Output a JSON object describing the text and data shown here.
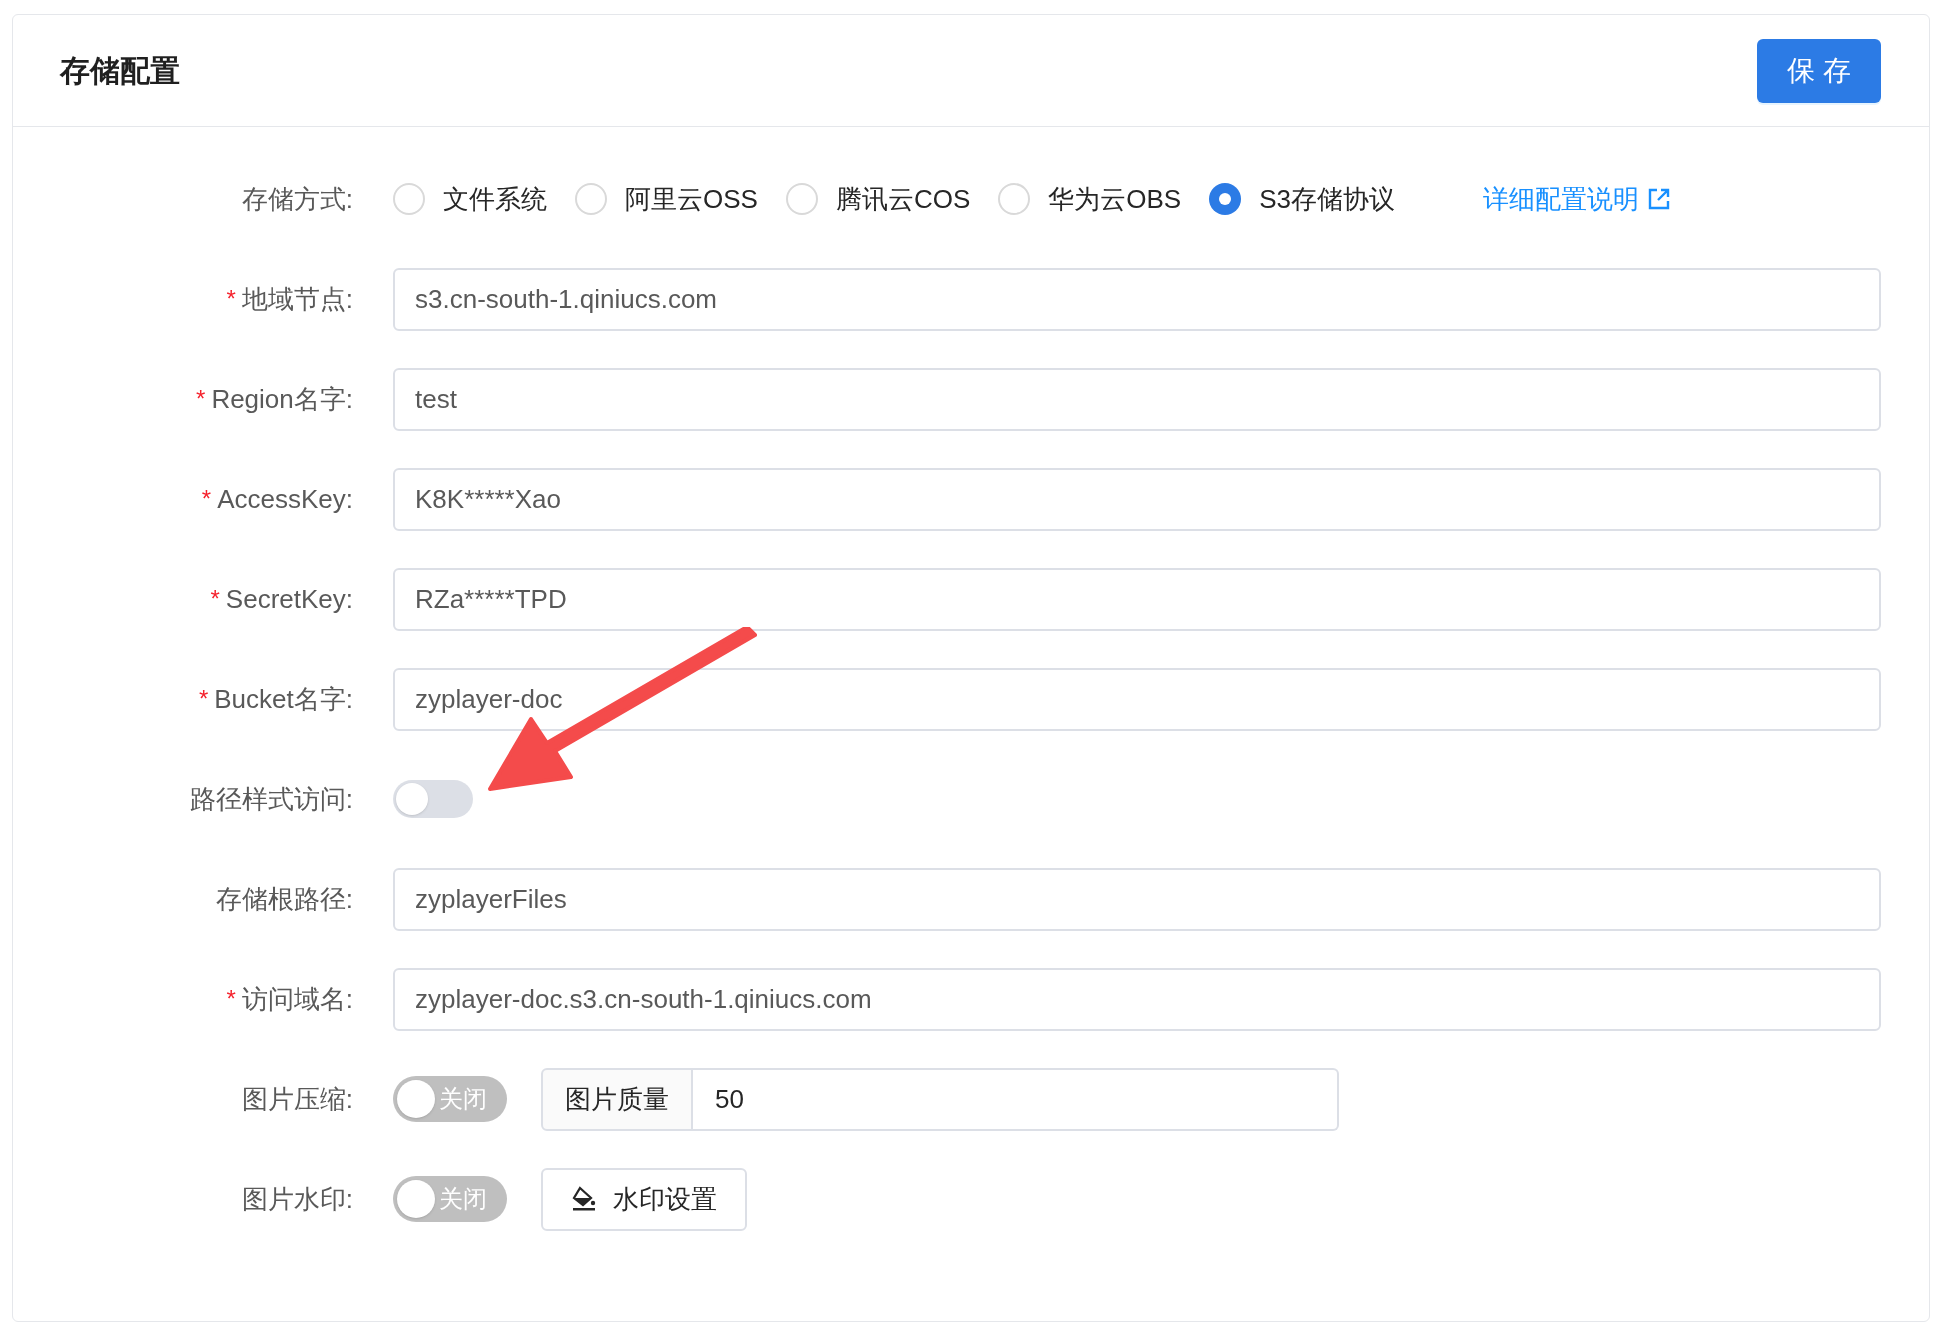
{
  "header": {
    "title": "存储配置",
    "save_button": "保 存"
  },
  "form": [
    {
      "kind": "radio",
      "label": "存储方式:",
      "options": [
        {
          "label": "文件系统",
          "selected": false
        },
        {
          "label": "阿里云OSS",
          "selected": false
        },
        {
          "label": "腾讯云COS",
          "selected": false
        },
        {
          "label": "华为云OBS",
          "selected": false
        },
        {
          "label": "S3存储协议",
          "selected": true
        }
      ],
      "link": "详细配置说明"
    },
    {
      "kind": "input",
      "label": "地域节点:",
      "required_mark": "*",
      "value": "s3.cn-south-1.qiniucs.com"
    },
    {
      "kind": "input",
      "label": "Region名字:",
      "required_mark": "*",
      "value": "test"
    },
    {
      "kind": "input",
      "label": "AccessKey:",
      "required_mark": "*",
      "value": "K8K*****Xao"
    },
    {
      "kind": "input",
      "label": "SecretKey:",
      "required_mark": "*",
      "value": "RZa*****TPD"
    },
    {
      "kind": "input",
      "label": "Bucket名字:",
      "required_mark": "*",
      "value": "zyplayer-doc"
    },
    {
      "kind": "switch",
      "label": "路径样式访问:",
      "on": false
    },
    {
      "kind": "input",
      "label": "存储根路径:",
      "value": "zyplayerFiles"
    },
    {
      "kind": "input",
      "label": "访问域名:",
      "required_mark": "*",
      "value": "zyplayer-doc.s3.cn-south-1.qiniucs.com"
    },
    {
      "kind": "switch_input",
      "label": "图片压缩:",
      "on": false,
      "switch_text": "关闭",
      "addon": "图片质量",
      "value": "50"
    },
    {
      "kind": "switch_button",
      "label": "图片水印:",
      "on": false,
      "switch_text": "关闭",
      "button": "水印设置"
    }
  ]
}
